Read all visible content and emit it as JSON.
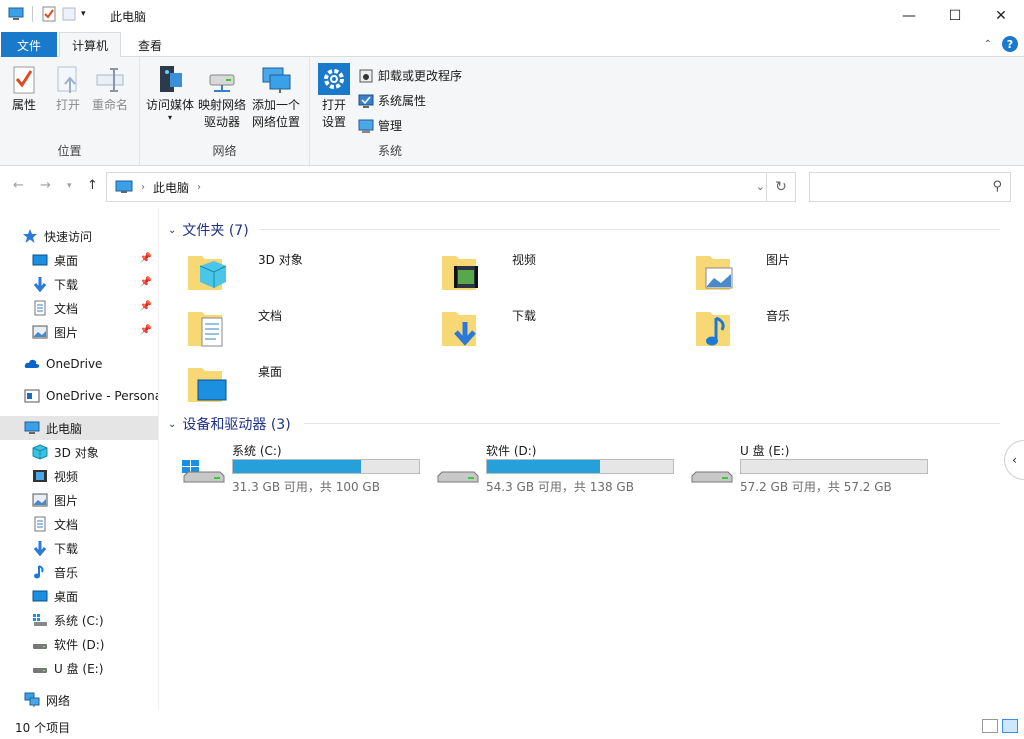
{
  "window": {
    "title": "此电脑",
    "minimize_icon": "minimize-icon",
    "maximize_icon": "maximize-icon",
    "close_icon": "close-icon"
  },
  "qat": {
    "items": [
      "computer-icon",
      "properties-icon",
      "new-folder-icon",
      "customize-dropdown-icon"
    ]
  },
  "tabs": {
    "file": "文件",
    "computer": "计算机",
    "view": "查看"
  },
  "ribbon": {
    "location": {
      "label": "位置",
      "properties": "属性",
      "open": "打开",
      "rename": "重命名"
    },
    "network": {
      "label": "网络",
      "access_media": "访问媒体",
      "map_drive_1": "映射网络",
      "map_drive_2": "驱动器",
      "add_location_1": "添加一个",
      "add_location_2": "网络位置"
    },
    "system": {
      "label": "系统",
      "open_settings_1": "打开",
      "open_settings_2": "设置",
      "uninstall": "卸载或更改程序",
      "system_properties": "系统属性",
      "manage": "管理"
    }
  },
  "address": {
    "crumb": "此电脑",
    "search_placeholder": ""
  },
  "sidebar": {
    "quick_access": "快速访问",
    "quick_items": [
      "桌面",
      "下载",
      "文档",
      "图片"
    ],
    "onedrive": "OneDrive",
    "onedrive_personal": "OneDrive - Persona",
    "this_pc": "此电脑",
    "pc_items": [
      "3D 对象",
      "视频",
      "图片",
      "文档",
      "下载",
      "音乐",
      "桌面",
      "系统 (C:)",
      "软件 (D:)",
      "U 盘 (E:)"
    ],
    "network": "网络"
  },
  "content": {
    "folders_header": "文件夹 (7)",
    "folders": [
      "3D 对象",
      "视频",
      "图片",
      "文档",
      "下载",
      "音乐",
      "桌面"
    ],
    "drives_header": "设备和驱动器 (3)",
    "drives": [
      {
        "name": "系统 (C:)",
        "size": "31.3 GB 可用，共 100 GB",
        "used_fraction": 0.687
      },
      {
        "name": "软件 (D:)",
        "size": "54.3 GB 可用，共 138 GB",
        "used_fraction": 0.607
      },
      {
        "name": "U 盘 (E:)",
        "size": "57.2 GB 可用，共 57.2 GB",
        "used_fraction": 0.0
      }
    ]
  },
  "status": {
    "count": "10 个项目"
  },
  "colors": {
    "accent": "#1979ca",
    "folder": "#f8d775",
    "drive_fill": "#26a0da",
    "section_header": "#1e3287"
  }
}
